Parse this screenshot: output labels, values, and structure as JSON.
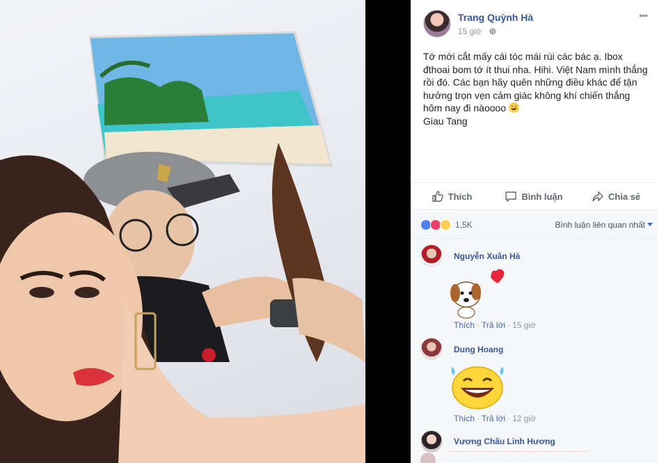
{
  "post": {
    "author": "Trang Quỳnh Hà",
    "time": "15 giờ",
    "text": "Tớ mới cắt mấy cái tóc mái rùi các bác ạ. Ibox\nđthoai bom tớ ít thui nha. Hihi. Việt Nam mình thắng\nrồi đó. Các bạn hãy quên những điều khác để tận\nhưởng trọn vẹn cảm giác không khí chiến thắng\nhôm nay đi nàoooo",
    "emoji_icon": "rofl-emoji",
    "signature": "Giau Tang",
    "photo_description_icon": "haircut-selfie-photo"
  },
  "actions": {
    "like": "Thích",
    "comment": "Bình luận",
    "share": "Chia sẻ"
  },
  "reactions": {
    "icons": [
      "like-icon",
      "love-icon",
      "haha-icon"
    ],
    "count": "1,5K",
    "sort_label": "Bình luận liên quan nhất"
  },
  "comments": [
    {
      "name": "Nguyễn Xuân Hà",
      "sticker": "puppy-heart-sticker",
      "like": "Thích",
      "reply": "Trả lời",
      "time": "15 giờ"
    },
    {
      "name": "Dung Hoang",
      "sticker": "laughing-tears-sticker",
      "like": "Thích",
      "reply": "Trả lời",
      "time": "12 giờ"
    },
    {
      "name": "Vương Châu Linh Hương"
    }
  ],
  "colors": {
    "link_blue": "#365899",
    "action_gray": "#606770",
    "meta_gray": "#90949c",
    "panel_bg": "#f6f7f9"
  }
}
